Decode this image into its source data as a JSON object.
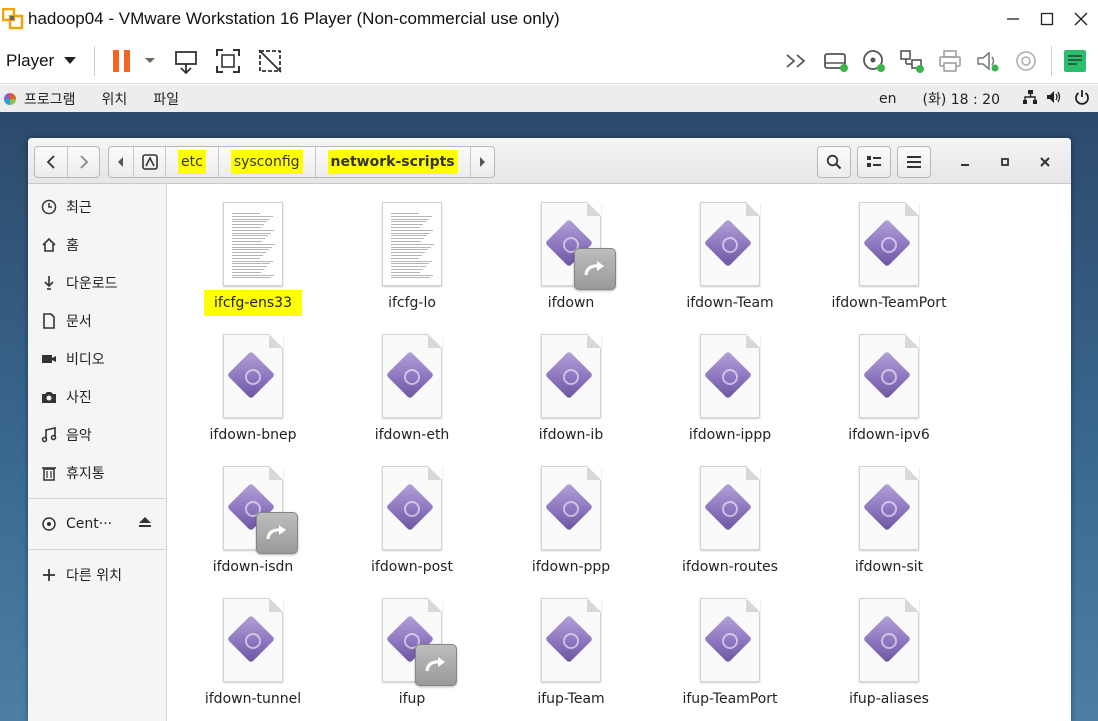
{
  "vm_window": {
    "title": "hadoop04 - VMware Workstation 16 Player (Non-commercial use only)",
    "player_menu_label": "Player"
  },
  "gnome_bar": {
    "menus": [
      "프로그램",
      "위치",
      "파일"
    ],
    "input_lang": "en",
    "clock": "(화) 18 : 20"
  },
  "path_bar": {
    "segments": [
      "etc",
      "sysconfig",
      "network-scripts"
    ]
  },
  "sidebar": {
    "items": [
      {
        "label": "최근",
        "icon": "clock-icon"
      },
      {
        "label": "홈",
        "icon": "home-icon"
      },
      {
        "label": "다운로드",
        "icon": "download-icon"
      },
      {
        "label": "문서",
        "icon": "document-icon"
      },
      {
        "label": "비디오",
        "icon": "video-icon"
      },
      {
        "label": "사진",
        "icon": "camera-icon"
      },
      {
        "label": "음악",
        "icon": "music-icon"
      },
      {
        "label": "휴지통",
        "icon": "trash-icon"
      }
    ],
    "device": {
      "label": "Cent···",
      "icon": "disc-icon"
    },
    "other": {
      "label": "다른 위치",
      "icon": "plus-icon"
    }
  },
  "files": [
    {
      "name": "ifcfg-ens33",
      "type": "text",
      "highlight": true
    },
    {
      "name": "ifcfg-lo",
      "type": "text"
    },
    {
      "name": "ifdown",
      "type": "script-link"
    },
    {
      "name": "ifdown-Team",
      "type": "script"
    },
    {
      "name": "ifdown-TeamPort",
      "type": "script"
    },
    {
      "name": "ifdown-bnep",
      "type": "script"
    },
    {
      "name": "ifdown-eth",
      "type": "script"
    },
    {
      "name": "ifdown-ib",
      "type": "script"
    },
    {
      "name": "ifdown-ippp",
      "type": "script"
    },
    {
      "name": "ifdown-ipv6",
      "type": "script"
    },
    {
      "name": "ifdown-isdn",
      "type": "script-link"
    },
    {
      "name": "ifdown-post",
      "type": "script"
    },
    {
      "name": "ifdown-ppp",
      "type": "script"
    },
    {
      "name": "ifdown-routes",
      "type": "script"
    },
    {
      "name": "ifdown-sit",
      "type": "script"
    },
    {
      "name": "ifdown-tunnel",
      "type": "script"
    },
    {
      "name": "ifup",
      "type": "script-link"
    },
    {
      "name": "ifup-Team",
      "type": "script"
    },
    {
      "name": "ifup-TeamPort",
      "type": "script"
    },
    {
      "name": "ifup-aliases",
      "type": "script"
    }
  ],
  "colors": {
    "highlight": "#ffff00",
    "pause_orange": "#f26522",
    "note_green": "#2dbd6e",
    "script_purple": "#8d76bf"
  }
}
